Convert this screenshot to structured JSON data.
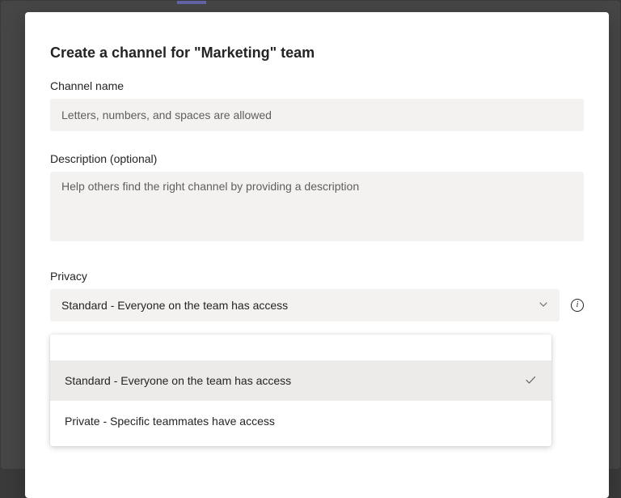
{
  "dialog": {
    "title": "Create a channel for \"Marketing\" team",
    "channel_name": {
      "label": "Channel name",
      "placeholder": "Letters, numbers, and spaces are allowed",
      "value": ""
    },
    "description": {
      "label": "Description (optional)",
      "placeholder": "Help others find the right channel by providing a description",
      "value": ""
    },
    "privacy": {
      "label": "Privacy",
      "selected": "Standard - Everyone on the team has access",
      "options": [
        "Standard - Everyone on the team has access",
        "Private - Specific teammates have access"
      ],
      "selected_index": 0
    }
  }
}
